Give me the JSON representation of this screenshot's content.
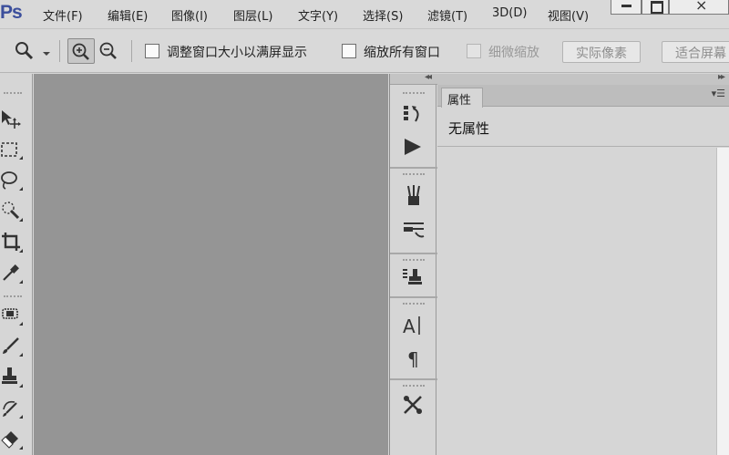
{
  "app": {
    "logo_text": "Ps"
  },
  "menu": {
    "items": [
      "文件(F)",
      "编辑(E)",
      "图像(I)",
      "图层(L)",
      "文字(Y)",
      "选择(S)",
      "滤镜(T)",
      "3D(D)",
      "视图(V)"
    ]
  },
  "options_bar": {
    "tool_icon": "zoom-icon",
    "zoom_in_icon": "zoom-in-icon",
    "zoom_out_icon": "zoom-out-icon",
    "resize_windows_label": "调整窗口大小以满屏显示",
    "zoom_all_windows_label": "缩放所有窗口",
    "scrubby_zoom_label": "细微缩放",
    "actual_pixels_label": "实际像素",
    "fit_screen_label": "适合屏幕"
  },
  "toolbox": {
    "tools": [
      "move-tool-icon",
      "marquee-tool-icon",
      "lasso-tool-icon",
      "quick-selection-tool-icon",
      "crop-tool-icon",
      "eyedropper-tool-icon",
      "healing-brush-tool-icon",
      "brush-tool-icon",
      "clone-stamp-tool-icon",
      "history-brush-tool-icon",
      "eraser-tool-icon"
    ]
  },
  "dock": {
    "icons": [
      "history-panel-icon",
      "actions-panel-icon",
      "brush-presets-icon",
      "brush-panel-icon",
      "clone-source-icon",
      "character-panel-icon",
      "paragraph-panel-icon",
      "tool-presets-icon"
    ]
  },
  "properties_panel": {
    "tab_label": "属性",
    "empty_text": "无属性"
  },
  "colors": {
    "chrome": "#d9d9d9",
    "canvas": "#959595",
    "logo": "#3c4f9c"
  }
}
